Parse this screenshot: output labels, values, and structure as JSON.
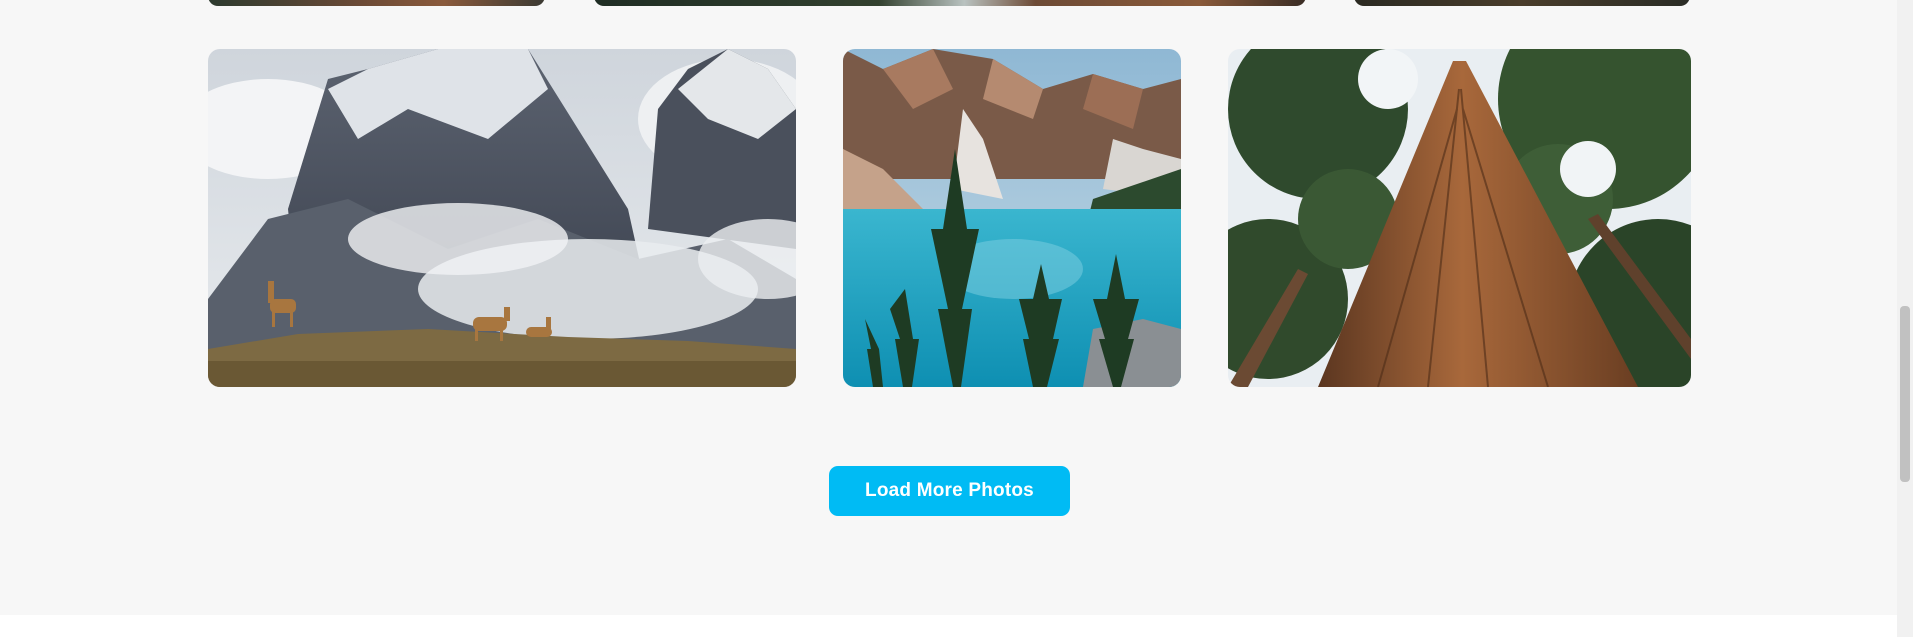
{
  "gallery": {
    "photos": [
      {
        "subject": "guanacos-mountains",
        "icon": "mountain-photo"
      },
      {
        "subject": "turquoise-lake",
        "icon": "lake-photo"
      },
      {
        "subject": "tall-tree-trunk",
        "icon": "tree-photo"
      }
    ]
  },
  "load_more": {
    "label": "Load More Photos"
  },
  "colors": {
    "accent": "#00bbf4",
    "background": "#f7f7f7"
  }
}
